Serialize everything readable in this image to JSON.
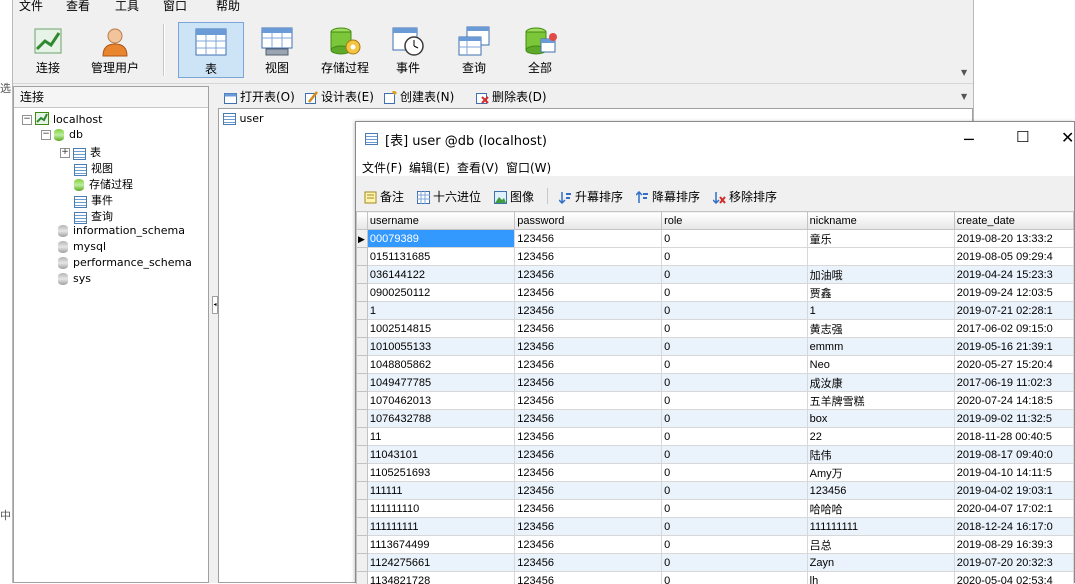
{
  "main_menu": [
    "文件",
    "查看",
    "工具",
    "窗口",
    "帮助"
  ],
  "toolbar": [
    {
      "label": "连接",
      "icon": "connect-icon"
    },
    {
      "label": "管理用户",
      "icon": "user-icon"
    },
    {
      "label": "表",
      "icon": "table-icon",
      "selected": true
    },
    {
      "label": "视图",
      "icon": "view-icon"
    },
    {
      "label": "存储过程",
      "icon": "procedure-icon"
    },
    {
      "label": "事件",
      "icon": "event-icon"
    },
    {
      "label": "查询",
      "icon": "query-icon"
    },
    {
      "label": "全部",
      "icon": "all-icon"
    }
  ],
  "left_pane": {
    "header": "连接",
    "tree": {
      "connection": "localhost",
      "databases": [
        "db",
        "information_schema",
        "mysql",
        "performance_schema",
        "sys"
      ],
      "db_children": [
        "表",
        "视图",
        "存储过程",
        "事件",
        "查询"
      ]
    }
  },
  "obj_toolbar": [
    "打开表(O)",
    "设计表(E)",
    "创建表(N)",
    "删除表(D)"
  ],
  "obj_list": [
    "user"
  ],
  "edge_text": {
    "top": "选",
    "bottom": "中"
  },
  "sub_window": {
    "title": "[表] user @db (localhost)",
    "menu": [
      "文件(F)",
      "编辑(E)",
      "查看(V)",
      "窗口(W)"
    ],
    "toolbar": [
      "备注",
      "十六进位",
      "图像",
      "升幕排序",
      "降幕排序",
      "移除排序"
    ],
    "columns": [
      "username",
      "password",
      "role",
      "nickname",
      "create_date"
    ],
    "rows": [
      [
        "00079389",
        "123456",
        "0",
        "童乐",
        "2019-08-20 13:33:2"
      ],
      [
        "0151131685",
        "123456",
        "0",
        "",
        "2019-08-05 09:29:4"
      ],
      [
        "036144122",
        "123456",
        "0",
        "加油哦",
        "2019-04-24 15:23:3"
      ],
      [
        "0900250112",
        "123456",
        "0",
        "贾鑫",
        "2019-09-24 12:03:5"
      ],
      [
        "1",
        "123456",
        "0",
        "1",
        "2019-07-21 02:28:1"
      ],
      [
        "1002514815",
        "123456",
        "0",
        "黄志强",
        "2017-06-02 09:15:0"
      ],
      [
        "1010055133",
        "123456",
        "0",
        "emmm",
        "2019-05-16 21:39:1"
      ],
      [
        "1048805862",
        "123456",
        "0",
        "Neo",
        "2020-05-27 15:20:4"
      ],
      [
        "1049477785",
        "123456",
        "0",
        "成汝康",
        "2017-06-19 11:02:3"
      ],
      [
        "1070462013",
        "123456",
        "0",
        "五羊牌雪糕",
        "2020-07-24 14:18:5"
      ],
      [
        "1076432788",
        "123456",
        "0",
        "box",
        "2019-09-02 11:32:5"
      ],
      [
        "11",
        "123456",
        "0",
        "22",
        "2018-11-28 00:40:5"
      ],
      [
        "11043101",
        "123456",
        "0",
        "陆伟",
        "2019-08-17 09:40:0"
      ],
      [
        "1105251693",
        "123456",
        "0",
        "Amy万",
        "2019-04-10 14:11:5"
      ],
      [
        "111111",
        "123456",
        "0",
        "123456",
        "2019-04-02 19:03:1"
      ],
      [
        "111111110",
        "123456",
        "0",
        "哈哈哈",
        "2020-04-07 17:02:1"
      ],
      [
        "111111111",
        "123456",
        "0",
        "111111111",
        "2018-12-24 16:17:0"
      ],
      [
        "1113674499",
        "123456",
        "0",
        "吕总",
        "2019-08-29 16:39:3"
      ],
      [
        "1124275661",
        "123456",
        "0",
        "Zayn",
        "2019-07-20 20:32:3"
      ],
      [
        "1134821728",
        "123456",
        "0",
        "lh",
        "2020-05-04 02:53:4"
      ]
    ]
  }
}
